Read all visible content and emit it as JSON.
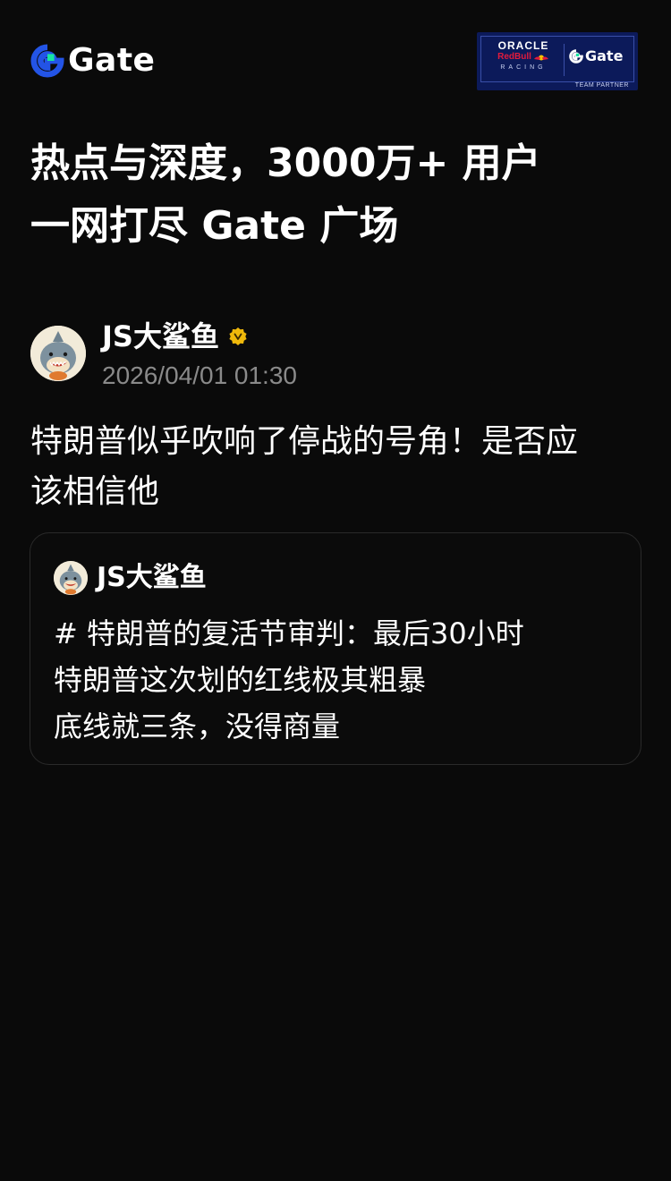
{
  "header": {
    "logo_text": "Gate",
    "logo_icon": "gate-logo-icon",
    "partner_badge": {
      "oracle": "ORACLE",
      "redbull": "RedBull",
      "racing": "RACING",
      "gate": "Gate",
      "team_partner": "TEAM PARTNER"
    }
  },
  "headline": {
    "line1": "热点与深度，3000万+ 用户",
    "line2": "一网打尽 Gate 广场"
  },
  "post": {
    "author_name": "JS大鲨鱼",
    "verified_icon": "verified-badge-icon",
    "timestamp": "2026/04/01 01:30",
    "text_line1": "特朗普似乎吹响了停战的号角！是否应",
    "text_line2": "该相信他"
  },
  "quote": {
    "author_name": "JS大鲨鱼",
    "lines": [
      "# 特朗普的复活节审判：最后30小时",
      "特朗普这次划的红线极其粗暴",
      "底线就三条，没得商量"
    ]
  },
  "colors": {
    "background": "#0a0a0a",
    "brand_blue": "#2354e6",
    "brand_green": "#17e6a1",
    "verified_gold": "#f0b90b",
    "muted_text": "#8a8a8a",
    "card_border": "#2a2a2a",
    "partner_navy": "#0c1a5a"
  }
}
